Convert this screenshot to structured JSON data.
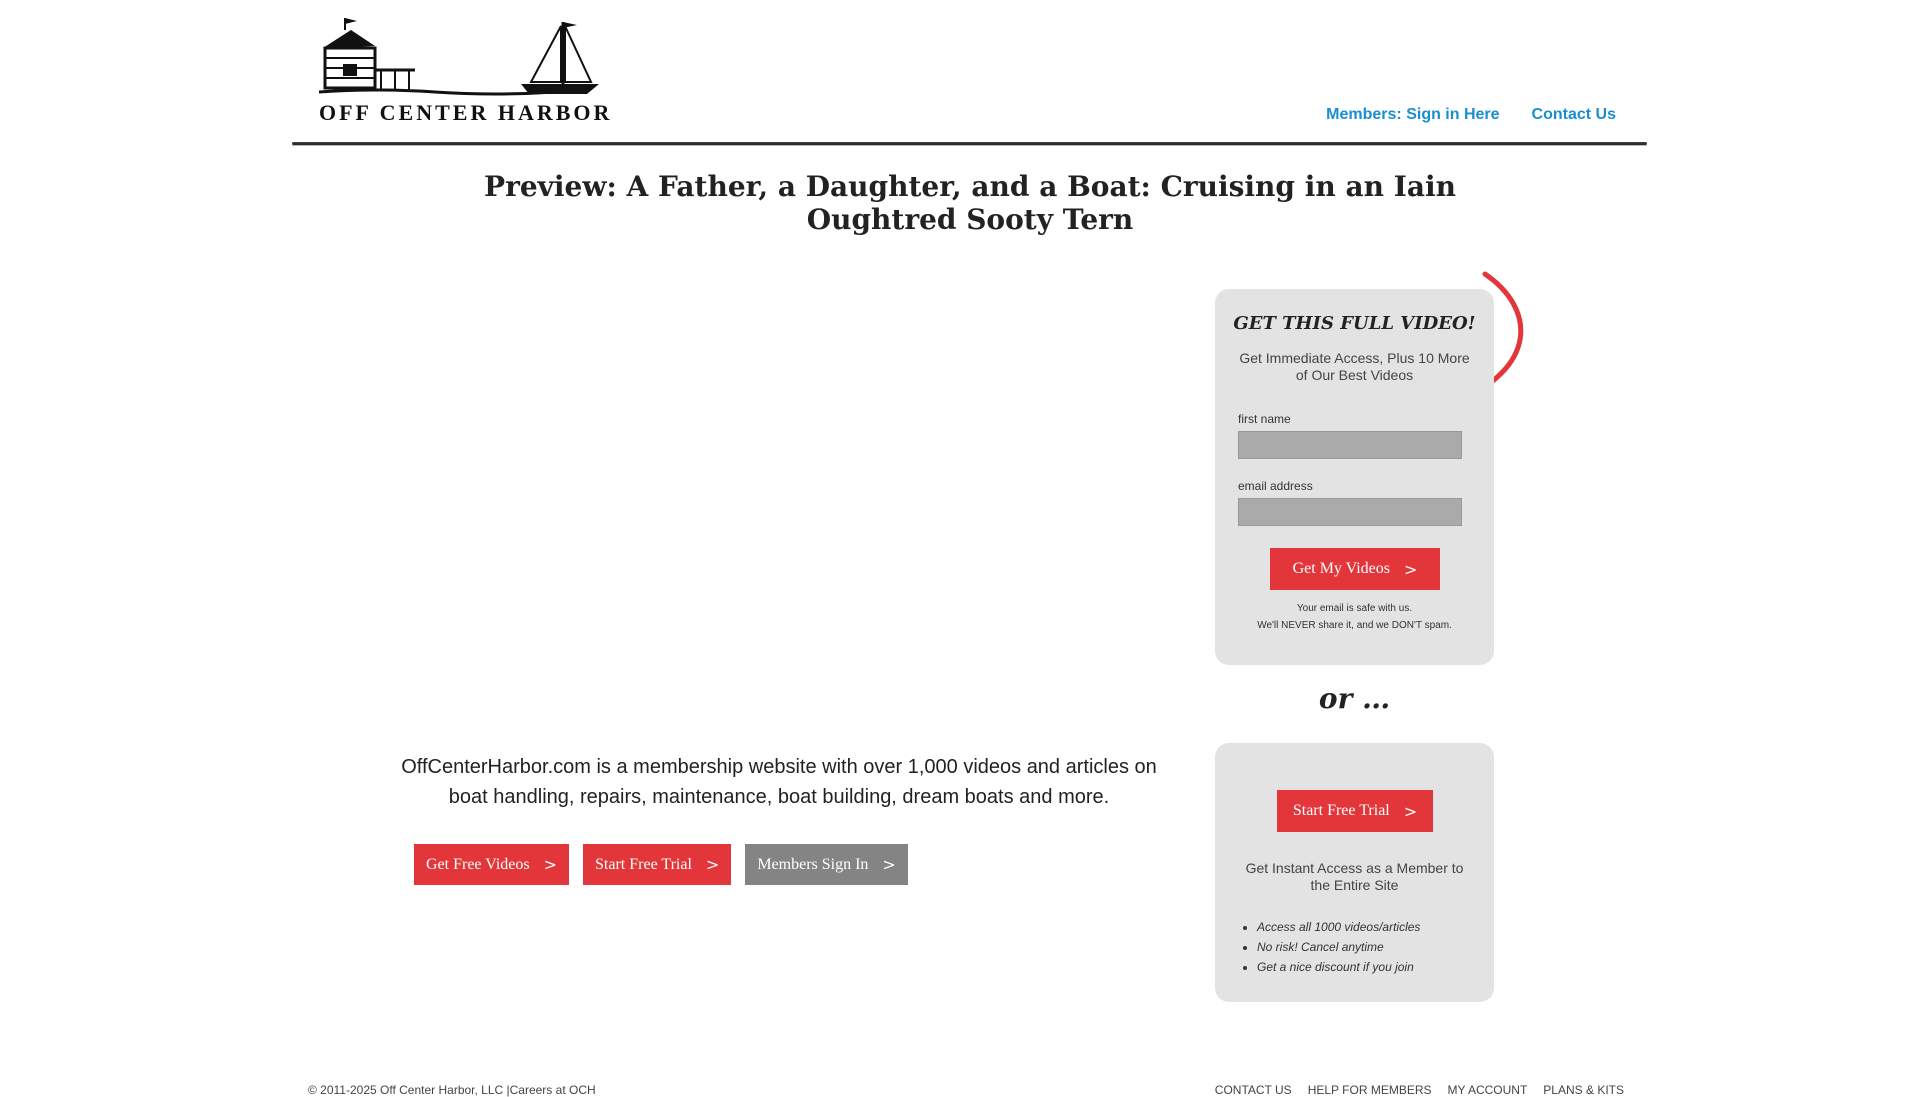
{
  "header": {
    "logo_text": "OFF CENTER HARBOR",
    "nav": [
      "Members: Sign in Here",
      "Contact Us"
    ]
  },
  "page": {
    "title": "Preview: A Father, a Daughter, and a Boat: Cruising in an Iain Oughtred Sooty Tern"
  },
  "main": {
    "lead": "OffCenterHarbor.com is a membership website with over 1,000 videos and articles on boat handling, repairs, maintenance, boat building, dream boats and more.",
    "buttons": [
      "Get Free Videos",
      "Start Free Trial",
      "Members Sign In"
    ],
    "chevron": ">"
  },
  "signup": {
    "heading": "GET THIS FULL VIDEO!",
    "sub": "Get Immediate Access, Plus 10 More of Our Best Videos",
    "first_name_label": "first name",
    "email_label": "email address",
    "button": "Get My Videos",
    "note_line1": "Your email is safe with us.",
    "note_line2": "We'll NEVER share it, and we DON'T spam."
  },
  "or_text": "or …",
  "trial": {
    "button": "Start Free Trial",
    "sub": "Get Instant Access as a Member to the Entire Site",
    "features": [
      "Access all 1000 videos/articles",
      "No risk! Cancel anytime",
      "Get a nice discount if you join"
    ]
  },
  "footer": {
    "copyright": "© 2011-2025 Off Center Harbor, LLC |Careers at OCH",
    "links": [
      "CONTACT US",
      "HELP FOR MEMBERS",
      "MY ACCOUNT",
      "PLANS & KITS"
    ]
  },
  "colors": {
    "accent_red": "#e3363a",
    "link_blue": "#1a8fd0",
    "panel_gray": "#e3e3e3",
    "button_gray": "#848484"
  }
}
